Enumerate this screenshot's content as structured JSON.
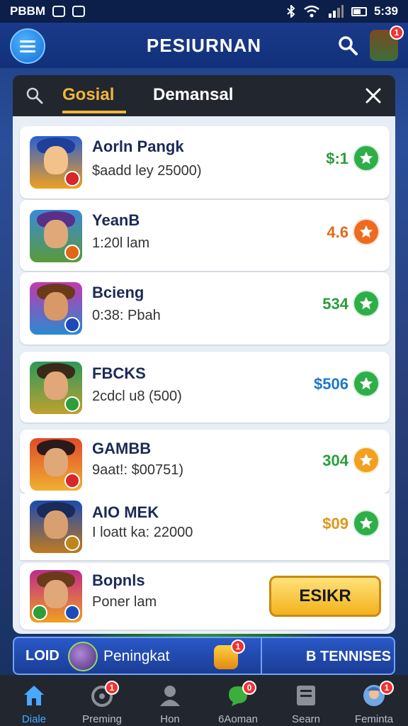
{
  "status_bar": {
    "carrier": "PBBM",
    "time": "5:39"
  },
  "app_bar": {
    "title": "PESIURNAN",
    "notification_count": "1"
  },
  "tabs": [
    {
      "label": "Gosial",
      "active": true
    },
    {
      "label": "Demansal",
      "active": false
    }
  ],
  "list": [
    {
      "name": "Aorln Pangk",
      "sub": "$aadd ley 25000)",
      "score": "$:1",
      "score_color": "#2a9d3a",
      "badge_color": "#2eae48"
    },
    {
      "name": "YeanB",
      "sub": "1:20l lam",
      "score": "4.6",
      "score_color": "#e06a1a",
      "badge_color": "#ee6b1e"
    },
    {
      "name": "Bcieng",
      "sub": "0:38: Pbah",
      "score": "534",
      "score_color": "#2a9d3a",
      "badge_color": "#2eae48"
    },
    {
      "name": "FBCKS",
      "sub": "2cdcl u8 (500)",
      "score": "$506",
      "score_color": "#1e78c8",
      "badge_color": "#2eae48"
    },
    {
      "name": "GAMBB",
      "sub": "9aat!: $00751)",
      "score": "304",
      "score_color": "#2a9d3a",
      "badge_color": "#f2a01e"
    },
    {
      "name": "AIO MEK",
      "sub": "I loatt ka: 22000",
      "score": "$09",
      "score_color": "#e0951a",
      "badge_color": "#2eae48"
    },
    {
      "name": "Bopnls",
      "sub": "Poner lam",
      "action_label": "ESIKR"
    }
  ],
  "promo": {
    "left_label": "LOID",
    "center_label": "Peningkat",
    "right_label": "B TENNISES",
    "gift_badge": "1"
  },
  "bottom_nav": [
    {
      "label": "Diale",
      "icon": "home-icon",
      "badge": "",
      "active": true
    },
    {
      "label": "Preming",
      "icon": "wheel-icon",
      "badge": "1",
      "active": false
    },
    {
      "label": "Hon",
      "icon": "person-icon",
      "badge": "",
      "active": false
    },
    {
      "label": "6Aoman",
      "icon": "chat-icon",
      "badge": "0",
      "active": false
    },
    {
      "label": "Searn",
      "icon": "card-icon",
      "badge": "",
      "active": false
    },
    {
      "label": "Feminta",
      "icon": "profile-icon",
      "badge": "1",
      "active": false
    }
  ],
  "colors": {
    "accent": "#f0b63a",
    "nav_active": "#49a8ff",
    "app_bar": "#1a3a8a"
  }
}
